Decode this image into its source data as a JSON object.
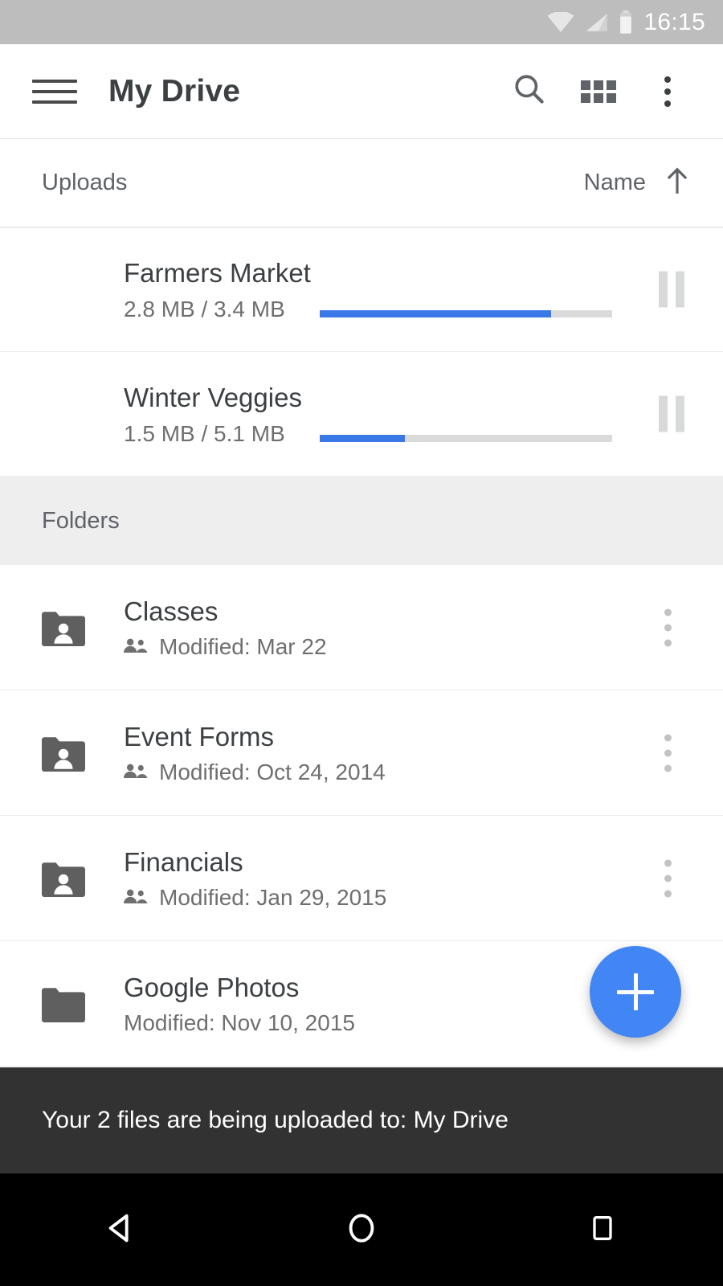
{
  "status_bar": {
    "time": "16:15",
    "icons": [
      "wifi-icon",
      "cell-signal-icon",
      "battery-icon"
    ],
    "background_color": "#bdbdbd"
  },
  "toolbar": {
    "menu_icon": "hamburger-menu-icon",
    "title": "My Drive",
    "actions": [
      {
        "name": "search-icon",
        "label": "Search"
      },
      {
        "name": "grid-view-icon",
        "label": "Grid view"
      },
      {
        "name": "overflow-menu-icon",
        "label": "More options"
      }
    ]
  },
  "sort_bar": {
    "section_label": "Uploads",
    "sort_label": "Name",
    "sort_direction_icon": "arrow-up-icon"
  },
  "uploads": [
    {
      "name": "Farmers Market",
      "size": "2.8 MB / 3.4 MB",
      "uploaded_mb": 2.8,
      "total_mb": 3.4,
      "progress_percent": 79,
      "action_icon": "pause-icon"
    },
    {
      "name": "Winter Veggies",
      "size": "1.5 MB / 5.1 MB",
      "uploaded_mb": 1.5,
      "total_mb": 5.1,
      "progress_percent": 29,
      "action_icon": "pause-icon"
    }
  ],
  "folders_section": {
    "header": "Folders",
    "items": [
      {
        "name": "Classes",
        "modified": "Modified: Mar 22",
        "shared": true,
        "icon": "shared-folder-icon"
      },
      {
        "name": "Event Forms",
        "modified": "Modified: Oct 24, 2014",
        "shared": true,
        "icon": "shared-folder-icon"
      },
      {
        "name": "Financials",
        "modified": "Modified: Jan 29, 2015",
        "shared": true,
        "icon": "shared-folder-icon"
      },
      {
        "name": "Google Photos",
        "modified": "Modified: Nov 10, 2015",
        "shared": false,
        "icon": "folder-icon"
      }
    ]
  },
  "fab": {
    "icon": "plus-icon",
    "label": "Create new",
    "color": "#4285f4"
  },
  "snackbar": {
    "message": "Your 2 files are being uploaded to: My Drive",
    "background_color": "#323232"
  },
  "nav_bar": {
    "buttons": [
      {
        "name": "back-button",
        "icon": "back-triangle-icon"
      },
      {
        "name": "home-button",
        "icon": "home-circle-icon"
      },
      {
        "name": "recents-button",
        "icon": "recents-square-icon"
      }
    ]
  },
  "colors": {
    "progress": "#3b78e7",
    "progress_track": "#dadada",
    "accent": "#4285f4",
    "section_bg": "#eeeeee"
  }
}
